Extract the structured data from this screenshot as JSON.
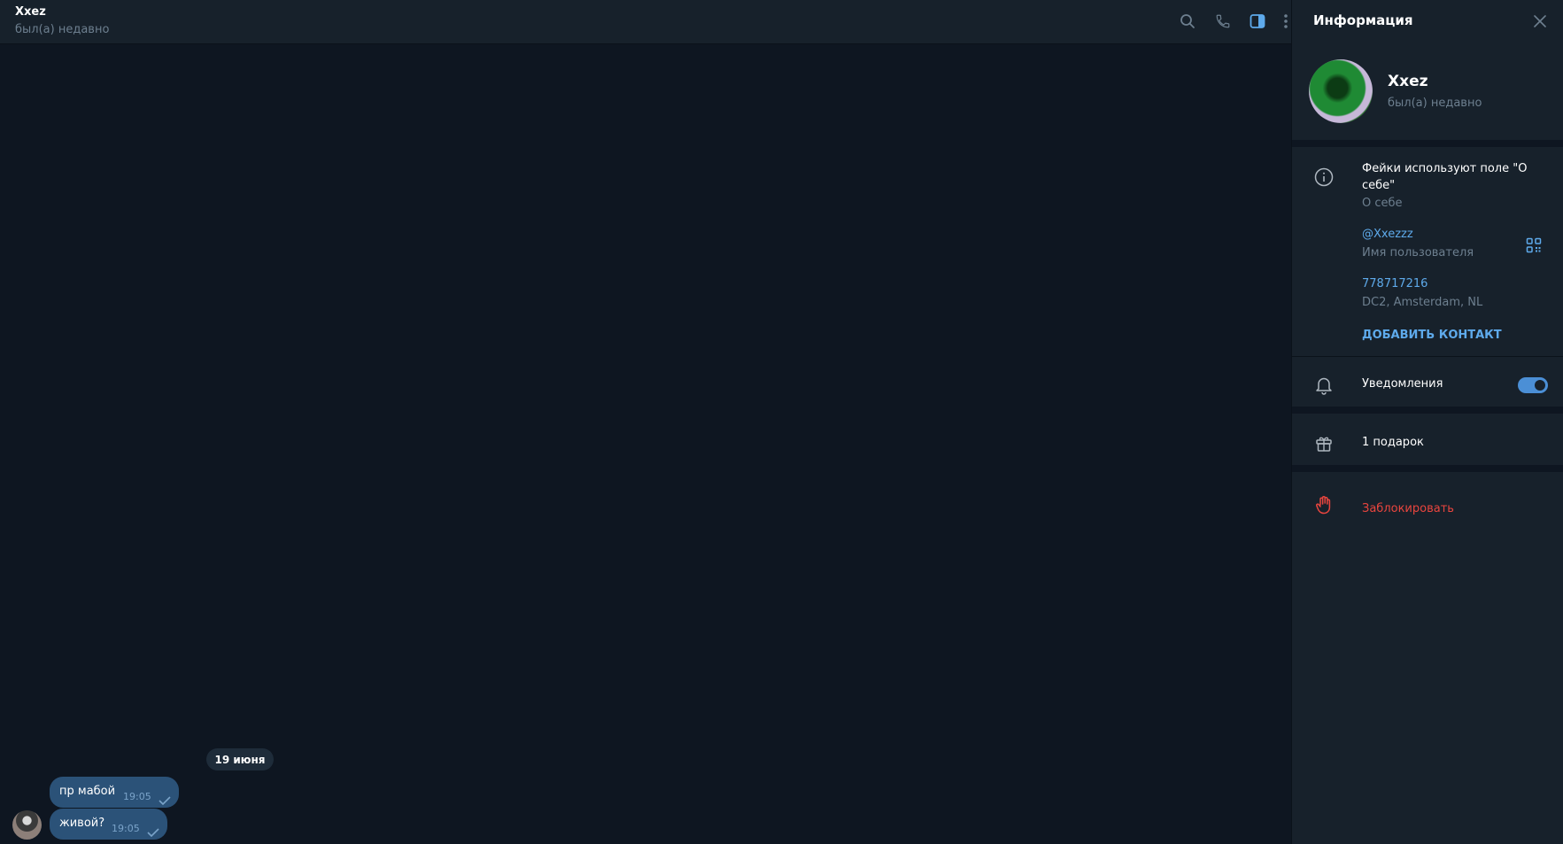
{
  "chat": {
    "title": "Xxez",
    "status": "был(а) недавно",
    "date_separator": "19 июня",
    "messages": [
      {
        "text": "пр мабой",
        "time": "19:05"
      },
      {
        "text": "живой?",
        "time": "19:05"
      }
    ],
    "header_icons": [
      "search-icon",
      "phone-icon",
      "sidebar-toggle-icon",
      "more-vertical-icon"
    ]
  },
  "panel": {
    "title": "Информация",
    "profile": {
      "name": "Xxez",
      "status": "был(а) недавно"
    },
    "bio": {
      "text": "Фейки используют поле \"О себе\"",
      "label": "О себе"
    },
    "username": {
      "value": "@Xxezzz",
      "label": "Имя пользователя"
    },
    "id": {
      "value": "778717216",
      "label": "DC2, Amsterdam, NL"
    },
    "add_contact_label": "ДОБАВИТЬ КОНТАКТ",
    "notifications": {
      "label": "Уведомления",
      "enabled": true
    },
    "gifts_label": "1 подарок",
    "block_label": "Заблокировать"
  },
  "colors": {
    "chat_bg": "#0e1621",
    "header_bg": "#17212b",
    "bubble_out": "#2b5278",
    "accent": "#5eaaeb",
    "danger": "#e9453e"
  }
}
